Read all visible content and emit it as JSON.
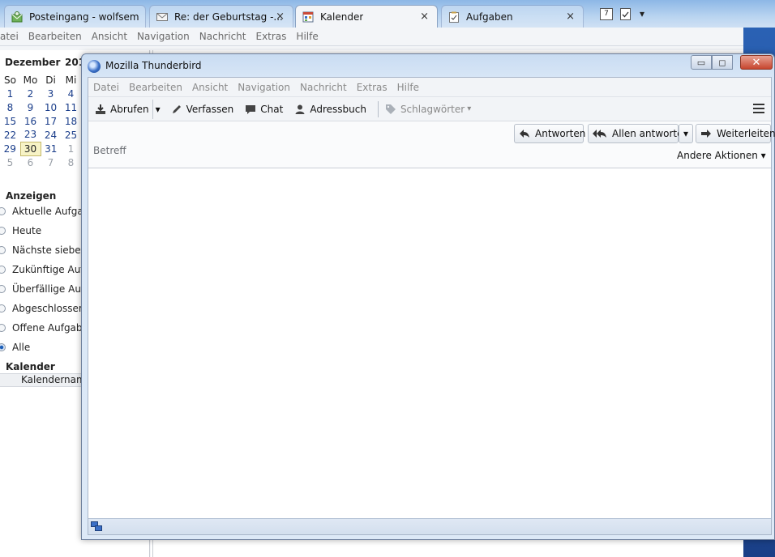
{
  "tabs": [
    {
      "label": "Posteingang - wolfsem...",
      "icon": "inbox-icon",
      "close": "×"
    },
    {
      "label": "Re: der Geburtstag -...",
      "icon": "envelope-icon",
      "close": "×"
    },
    {
      "label": "Kalender",
      "icon": "calendar-tab-icon",
      "close": "×"
    },
    {
      "label": "Aufgaben",
      "icon": "tasks-tab-icon",
      "close": "×"
    }
  ],
  "tab_extras": {
    "calendar_day": "7",
    "dropdown": "▾"
  },
  "bg_menu": [
    "atei",
    "Bearbeiten",
    "Ansicht",
    "Navigation",
    "Nachricht",
    "Extras",
    "Hilfe"
  ],
  "minicalendar": {
    "month": "Dezember",
    "year": "201",
    "weekdays": [
      "So",
      "Mo",
      "Di",
      "Mi"
    ],
    "rows": [
      [
        "1",
        "2",
        "3",
        "4"
      ],
      [
        "8",
        "9",
        "10",
        "11"
      ],
      [
        "15",
        "16",
        "17",
        "18"
      ],
      [
        "22",
        "23",
        "24",
        "25"
      ],
      [
        "29",
        "30",
        "31",
        "1"
      ],
      [
        "5",
        "6",
        "7",
        "8"
      ]
    ],
    "today": "30"
  },
  "filter": {
    "title": "Anzeigen",
    "options": [
      "Aktuelle Aufgab",
      "Heute",
      "Nächste sieben T",
      "Zukünftige Aufg",
      "Überfällige Aufg",
      "Abgeschlossene",
      "Offene Aufgabe",
      "Alle"
    ],
    "selected": "Alle"
  },
  "calendars": {
    "title": "Kalender",
    "column": "Kalendername"
  },
  "popup": {
    "title": "Mozilla Thunderbird",
    "window_buttons": {
      "minimize": "▭",
      "maximize": "◻",
      "close": "✕"
    },
    "menu": [
      "Datei",
      "Bearbeiten",
      "Ansicht",
      "Navigation",
      "Nachricht",
      "Extras",
      "Hilfe"
    ],
    "toolbar": {
      "get": "Abrufen",
      "compose": "Verfassen",
      "chat": "Chat",
      "addressbook": "Adressbuch",
      "tags": "Schlagwörter",
      "tags_arrow": "▾",
      "get_arrow": "▾"
    },
    "actions": {
      "reply": "Antworten",
      "reply_all": "Allen antworten",
      "forward": "Weiterleiten",
      "dd": "▾"
    },
    "subject_label": "Betreff",
    "other_actions": "Andere Aktionen ▾"
  },
  "colors": {
    "accent": "#1d5fb8",
    "today_bg": "#f7f3c6",
    "close_red": "#c7452e"
  }
}
